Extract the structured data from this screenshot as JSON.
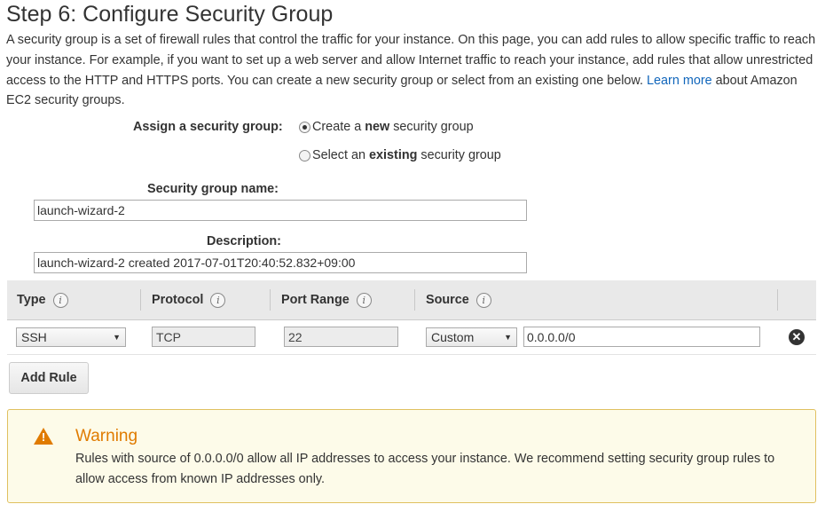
{
  "page": {
    "title": "Step 6: Configure Security Group",
    "intro_text": "A security group is a set of firewall rules that control the traffic for your instance. On this page, you can add rules to allow specific traffic to reach your instance. For example, if you want to set up a web server and allow Internet traffic to reach your instance, add rules that allow unrestricted access to the HTTP and HTTPS ports. You can create a new security group or select from an existing one below.",
    "learn_more_link": "Learn more",
    "intro_suffix": "about Amazon EC2 security groups."
  },
  "assign": {
    "label": "Assign a security group:",
    "option_new_pre": "Create a",
    "option_new_bold": "new",
    "option_new_post": "security group",
    "option_existing_pre": "Select an",
    "option_existing_bold": "existing",
    "option_existing_post": "security group",
    "selected": "new"
  },
  "form": {
    "name_label": "Security group name:",
    "name_value": "launch-wizard-2",
    "description_label": "Description:",
    "description_value": "launch-wizard-2 created 2017-07-01T20:40:52.832+09:00"
  },
  "rules_table": {
    "columns": [
      "Type",
      "Protocol",
      "Port Range",
      "Source"
    ],
    "info_glyph": "i",
    "rows": [
      {
        "type": "SSH",
        "protocol": "TCP",
        "port_range": "22",
        "source_mode": "Custom",
        "source_value": "0.0.0.0/0"
      }
    ],
    "remove_glyph": "✕",
    "add_rule_label": "Add Rule"
  },
  "warning": {
    "icon_glyph": "!",
    "title": "Warning",
    "text": "Rules with source of 0.0.0.0/0 allow all IP addresses to access your instance. We recommend setting security group rules to allow access from known IP addresses only."
  },
  "colors": {
    "link": "#1166bb",
    "warning_accent": "#e07b00",
    "warning_bg": "#fdfbe9",
    "table_header_bg": "#e9e9e9"
  }
}
